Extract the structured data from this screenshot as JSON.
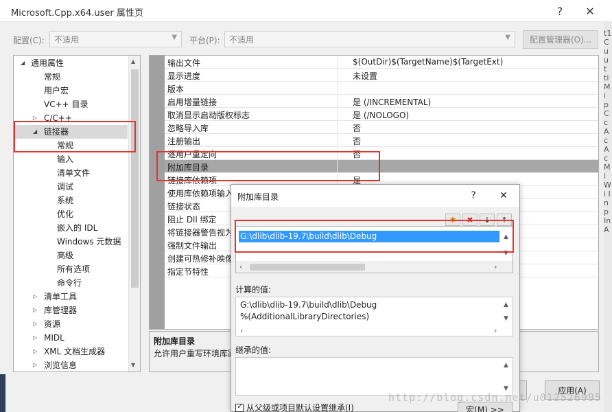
{
  "window": {
    "title": "Microsoft.Cpp.x64.user 属性页",
    "help": "?",
    "close": "✕"
  },
  "config": {
    "config_label": "配置(C):",
    "config_value": "不适用",
    "platform_label": "平台(P):",
    "platform_value": "不适用",
    "manager_button": "配置管理器(O)..."
  },
  "tree": {
    "items": [
      {
        "label": "通用属性",
        "arrow": "◢"
      },
      {
        "label": "常规"
      },
      {
        "label": "用户宏"
      },
      {
        "label": "VC++ 目录"
      },
      {
        "label": "C/C++",
        "arrow": "▷"
      },
      {
        "label": "链接器",
        "arrow": "◢"
      },
      {
        "label": "常规"
      },
      {
        "label": "输入"
      },
      {
        "label": "清单文件"
      },
      {
        "label": "调试"
      },
      {
        "label": "系统"
      },
      {
        "label": "优化"
      },
      {
        "label": "嵌入的 IDL"
      },
      {
        "label": "Windows 元数据"
      },
      {
        "label": "高级"
      },
      {
        "label": "所有选项"
      },
      {
        "label": "命令行"
      },
      {
        "label": "清单工具",
        "arrow": "▷"
      },
      {
        "label": "库管理器",
        "arrow": "▷"
      },
      {
        "label": "资源",
        "arrow": "▷"
      },
      {
        "label": "MIDL",
        "arrow": "▷"
      },
      {
        "label": "XML 文档生成器",
        "arrow": "▷"
      },
      {
        "label": "浏览信息",
        "arrow": "▷"
      }
    ]
  },
  "properties": [
    {
      "name": "输出文件",
      "value": "$(OutDir)$(TargetName)$(TargetExt)"
    },
    {
      "name": "显示进度",
      "value": "未设置"
    },
    {
      "name": "版本",
      "value": ""
    },
    {
      "name": "启用增量链接",
      "value": "是 (/INCREMENTAL)"
    },
    {
      "name": "取消显示启动版权标志",
      "value": "是 (/NOLOGO)"
    },
    {
      "name": "忽略导入库",
      "value": "否"
    },
    {
      "name": "注册输出",
      "value": "否"
    },
    {
      "name": "逐用户重定向",
      "value": "否"
    },
    {
      "name": "附加库目录",
      "value": ""
    },
    {
      "name": "链接库依赖项",
      "value": "是"
    },
    {
      "name": "使用库依赖项输入",
      "value": ""
    },
    {
      "name": "链接状态",
      "value": ""
    },
    {
      "name": "阻止 Dll 绑定",
      "value": ""
    },
    {
      "name": "将链接器警告视为",
      "value": ""
    },
    {
      "name": "强制文件输出",
      "value": ""
    },
    {
      "name": "创建可热修补映像",
      "value": ""
    },
    {
      "name": "指定节特性",
      "value": ""
    }
  ],
  "description": {
    "title": "附加库目录",
    "text": "允许用户重写环境库路"
  },
  "main_buttons": {
    "apply": "应用(A)"
  },
  "dialog": {
    "title": "附加库目录",
    "help": "?",
    "close": "✕",
    "toolbar": {
      "new": "✱",
      "delete": "✖",
      "down": "↓",
      "up": "↑"
    },
    "list_items": [
      "G:\\dlib\\dlib-19.7\\build\\dlib\\Debug"
    ],
    "computed_label": "计算的值:",
    "computed_values": [
      "G:\\dlib\\dlib-19.7\\build\\dlib\\Debug",
      "%(AdditionalLibraryDirectories)"
    ],
    "inherited_label": "继承的值:",
    "inherit_checkbox": "从父级或项目默认设置继承(I)",
    "inherit_checked": true,
    "macro_button": "宏(M) >>"
  },
  "background_edge_text": "t1 C u u t ti Mi p Cc Ac Ac Mi Wi In p In A",
  "watermark": "http://blog.csdn.net/u012526995",
  "colors": {
    "highlight_red": "#e0342d",
    "selection_blue": "#3399ff",
    "selected_gray": "#a7a7a7"
  }
}
